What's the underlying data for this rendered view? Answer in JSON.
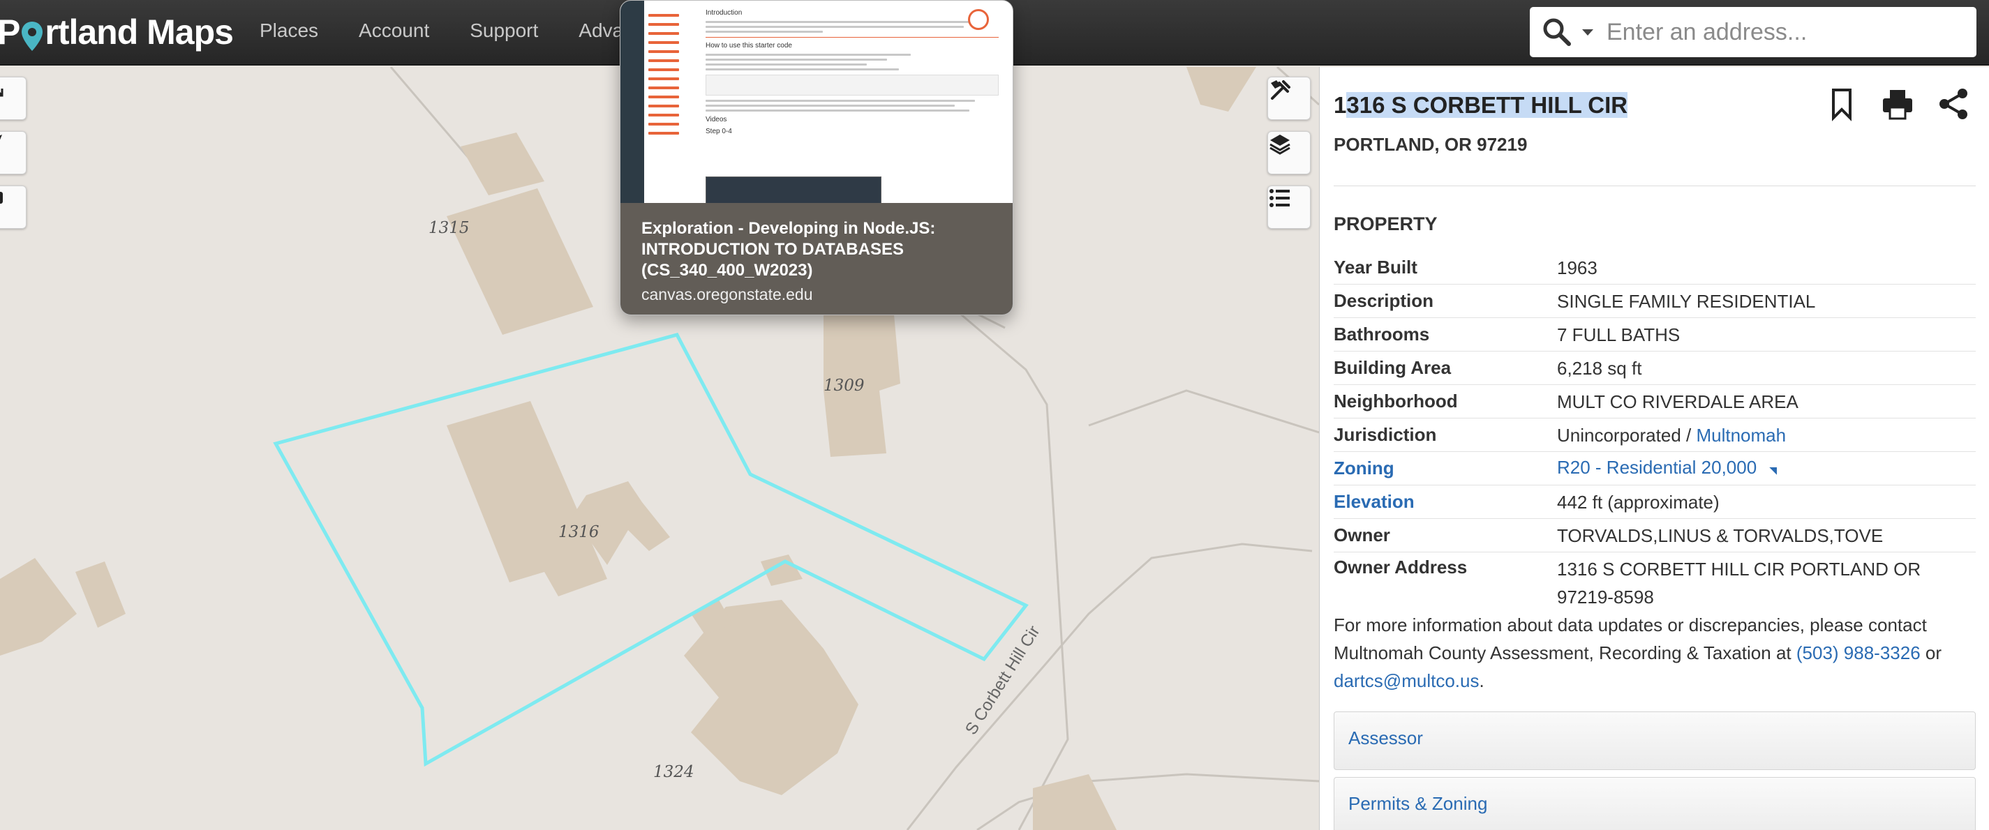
{
  "header": {
    "logo_left": "P",
    "logo_right": "rtland Maps",
    "nav": [
      "Places",
      "Account",
      "Support",
      "Adva"
    ],
    "search_placeholder": "Enter an address..."
  },
  "map": {
    "lot_labels": [
      "1315",
      "1309",
      "1316",
      "1324"
    ],
    "street_label": "S Corbett Hill Cir",
    "colors": {
      "background": "#e8e4df",
      "building": "#d8cbb9",
      "parcel_outline": "#7eeaf0",
      "road_line": "#c9c4bd"
    },
    "controls": [
      "fullscreen-icon",
      "locate-icon",
      "camera-icon",
      "tools-icon",
      "layers-icon",
      "legend-icon"
    ]
  },
  "preview": {
    "title": "Exploration - Developing in Node.JS: INTRODUCTION TO DATABASES (CS_340_400_W2023)",
    "url": "canvas.oregonstate.edu",
    "thumb": {
      "heading": "Introduction",
      "subheading": "How to use this starter code",
      "videos_heading": "Videos",
      "step": "Step 0-4"
    }
  },
  "panel": {
    "address_line1_prefix": "1",
    "address_line1_selected": "316 S CORBETT HILL CIR",
    "address_line2": "PORTLAND, OR 97219",
    "section": "PROPERTY",
    "icons": [
      "bookmark-icon",
      "print-icon",
      "share-icon"
    ],
    "properties": [
      {
        "label": "Year Built",
        "value": "1963"
      },
      {
        "label": "Description",
        "value": "SINGLE FAMILY RESIDENTIAL"
      },
      {
        "label": "Bathrooms",
        "value": "7 FULL BATHS"
      },
      {
        "label": "Building Area",
        "value": "6,218 sq ft"
      },
      {
        "label": "Neighborhood",
        "value": "MULT CO RIVERDALE AREA"
      },
      {
        "label": "Jurisdiction",
        "value_prefix": "Unincorporated / ",
        "value_link": "Multnomah"
      },
      {
        "label": "Zoning",
        "value": "R20 - Residential 20,000"
      },
      {
        "label": "Elevation",
        "value": "442 ft (approximate)"
      },
      {
        "label": "Owner",
        "value": "TORVALDS,LINUS & TORVALDS,TOVE"
      },
      {
        "label": "Owner Address",
        "value": "1316 S CORBETT HILL CIR PORTLAND OR 97219-8598"
      }
    ],
    "note": {
      "text1": "For more information about data updates or discrepancies, please contact Multnomah County Assessment, Recording & Taxation at ",
      "phone": "(503) 988-3326",
      "text2": " or ",
      "email": "dartcs@multco.us",
      "text3": "."
    },
    "accordions": [
      "Assessor",
      "Permits & Zoning"
    ]
  }
}
